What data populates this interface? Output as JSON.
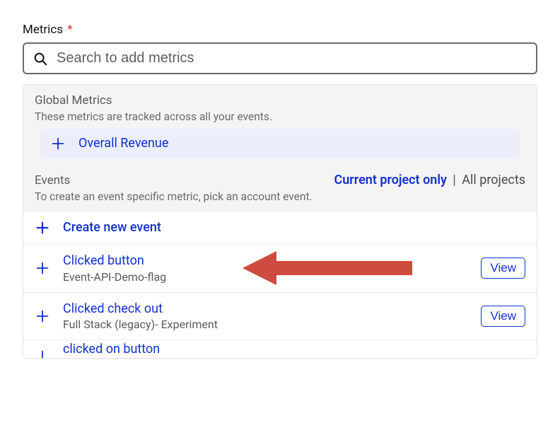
{
  "field": {
    "label": "Metrics",
    "required_indicator": "*"
  },
  "search": {
    "placeholder": "Search to add metrics",
    "value": ""
  },
  "global_section": {
    "title": "Global Metrics",
    "desc": "These metrics are tracked across all your events.",
    "items": [
      {
        "label": "Overall Revenue"
      }
    ]
  },
  "events_section": {
    "title": "Events",
    "filter_active": "Current project only",
    "filter_separator": "|",
    "filter_inactive": "All projects",
    "desc": "To create an event specific metric, pick an account event.",
    "create_label": "Create new event",
    "items": [
      {
        "label": "Clicked button",
        "sub": "Event-API-Demo-flag",
        "view_label": "View"
      },
      {
        "label": "Clicked check out",
        "sub": "Full Stack (legacy)- Experiment",
        "view_label": "View"
      },
      {
        "label": "clicked on button"
      }
    ]
  },
  "annotations": {
    "arrow_color": "#cd4b3f"
  }
}
